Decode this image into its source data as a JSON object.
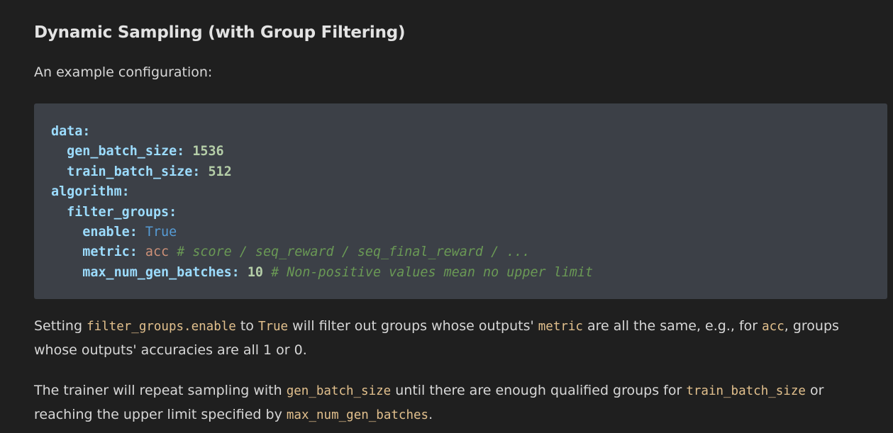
{
  "heading": "Dynamic Sampling (with Group Filtering)",
  "intro": "An example configuration:",
  "code": {
    "line1_key": "data:",
    "line2_key": "gen_batch_size:",
    "line2_val": "1536",
    "line3_key": "train_batch_size:",
    "line3_val": "512",
    "line4_key": "algorithm:",
    "line5_key": "filter_groups:",
    "line6_key": "enable:",
    "line6_val": "True",
    "line7_key": "metric:",
    "line7_val": "acc",
    "line7_comment": "# score / seq_reward / seq_final_reward / ...",
    "line8_key": "max_num_gen_batches:",
    "line8_val": "10",
    "line8_comment": "# Non-positive values mean no upper limit"
  },
  "para1": {
    "t1": "Setting ",
    "c1": "filter_groups.enable",
    "t2": " to ",
    "c2": "True",
    "t3": " will filter out groups whose outputs' ",
    "c3": "metric",
    "t4": " are all the same, e.g., for ",
    "c4": "acc",
    "t5": ", groups whose outputs' accuracies are all 1 or 0."
  },
  "para2": {
    "t1": "The trainer will repeat sampling with ",
    "c1": "gen_batch_size",
    "t2": " until there are enough qualified groups for ",
    "c2": "train_batch_size",
    "t3": " or reaching the upper limit specified by ",
    "c3": "max_num_gen_batches",
    "t4": "."
  }
}
